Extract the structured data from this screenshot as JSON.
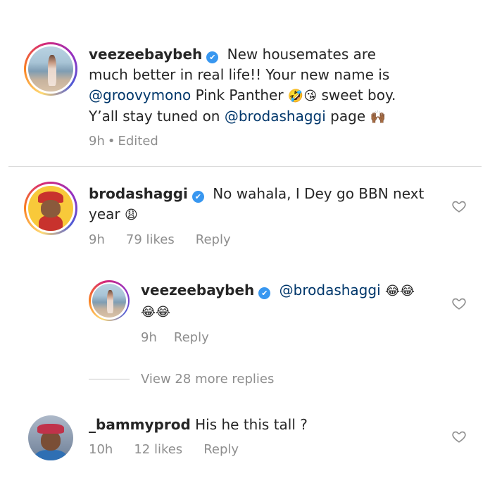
{
  "comments": [
    {
      "username": "veezeebaybeh",
      "verified": true,
      "text_line1": "New housemates are",
      "text_line2": "much better in real life!! Your new name is",
      "line3_mention": "@groovymono",
      "line3_text": " Pink Panther ",
      "line3_emojis": "🤣😘",
      "line3_tail": " sweet boy.",
      "line4_text": "Y’all stay tuned on ",
      "line4_mention": "@brodashaggi",
      "line4_tail": " page ",
      "line4_emoji": "🙌🏾",
      "time": "9h",
      "sep": "•",
      "edited": "Edited"
    },
    {
      "username": "brodashaggi",
      "verified": true,
      "text_line1": "No wahala, I Dey go BBN next",
      "text_line2": "year ",
      "emoji": "😩",
      "time": "9h",
      "likes": "79 likes",
      "reply": "Reply"
    }
  ],
  "reply": {
    "username": "veezeebaybeh",
    "verified": true,
    "mention": "@brodashaggi",
    "emoji_line1": "😂😂",
    "emoji_line2": "😂😂",
    "time": "9h",
    "reply": "Reply"
  },
  "view_more": "View 28 more replies",
  "last_comment": {
    "username": "_bammyprod",
    "text": "His he this tall ?",
    "time": "10h",
    "likes": "12 likes",
    "reply": "Reply"
  },
  "icons": {
    "verified": "✔",
    "heart": "heart-outline-icon"
  },
  "colors": {
    "mention": "#00376b",
    "meta": "#8e8e8e",
    "verified": "#3897f0"
  }
}
